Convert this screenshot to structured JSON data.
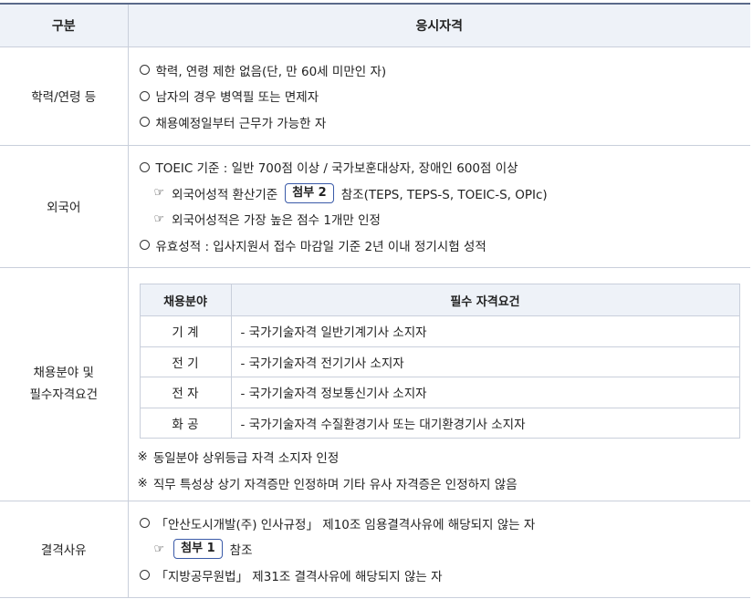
{
  "header": {
    "col1": "구분",
    "col2": "응시자격"
  },
  "rows": {
    "r1": {
      "label": "학력/연령 등",
      "lines": [
        "학력, 연령 제한 없음(단, 만 60세 미만인 자)",
        "남자의 경우 병역필 또는 면제자",
        "채용예정일부터 근무가 가능한 자"
      ]
    },
    "r2": {
      "label": "외국어",
      "l1": "TOEIC 기준 : 일반 700점 이상 / 국가보훈대상자, 장애인 600점 이상",
      "l2_pre": "외국어성적 환산기준",
      "l2_badge": "첨부 2",
      "l2_post": "참조(TEPS, TEPS-S, TOEIC-S, OPIc)",
      "l3": "외국어성적은 가장 높은 점수 1개만 인정",
      "l4": "유효성적 : 입사지원서 접수 마감일 기준 2년 이내 정기시험 성적"
    },
    "r3": {
      "label1": "채용분야 및",
      "label2": "필수자격요건",
      "inner_header": {
        "c1": "채용분야",
        "c2": "필수 자격요건"
      },
      "inner_rows": [
        {
          "field": "기 계",
          "req": "-  국가기술자격 일반기계기사 소지자"
        },
        {
          "field": "전 기",
          "req": "-  국가기술자격 전기기사 소지자"
        },
        {
          "field": "전 자",
          "req": "-  국가기술자격 정보통신기사 소지자"
        },
        {
          "field": "화 공",
          "req": "-  국가기술자격 수질환경기사 또는 대기환경기사 소지자"
        }
      ],
      "note1": "동일분야 상위등급 자격 소지자 인정",
      "note2": "직무 특성상 상기 자격증만 인정하며 기타 유사 자격증은 인정하지 않음"
    },
    "r4": {
      "label": "결격사유",
      "l1": "「안산도시개발(주) 인사규정」 제10조 임용결격사유에 해당되지 않는 자",
      "l2_badge": "첨부 1",
      "l2_post": "참조",
      "l3": "「지방공무원법」 제31조 결격사유에 해당되지 않는 자"
    }
  },
  "symbols": {
    "circle": "○",
    "hand": "☞",
    "note_mark": "※"
  },
  "colors": {
    "header_bg": "#eef2f8",
    "border": "#c9cfdb",
    "badge_border": "#3a5aa8"
  }
}
